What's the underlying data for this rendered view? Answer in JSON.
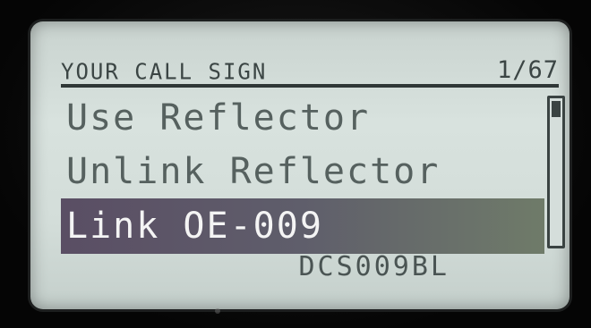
{
  "header": {
    "title": "YOUR CALL SIGN",
    "page_indicator": "1/67"
  },
  "menu": {
    "items": [
      {
        "label": "Use Reflector",
        "selected": false
      },
      {
        "label": "Unlink Reflector",
        "selected": false
      },
      {
        "label": "Link OE-009",
        "selected": true
      }
    ]
  },
  "scrollbar": {
    "position_fraction": 0.0
  },
  "footer": {
    "callsign": "DCS009BL"
  },
  "colors": {
    "lcd_background": "#d3ddd9",
    "text": "#56615f",
    "selected_background": "#5f5e6b",
    "selected_text": "#f4f4f4"
  }
}
